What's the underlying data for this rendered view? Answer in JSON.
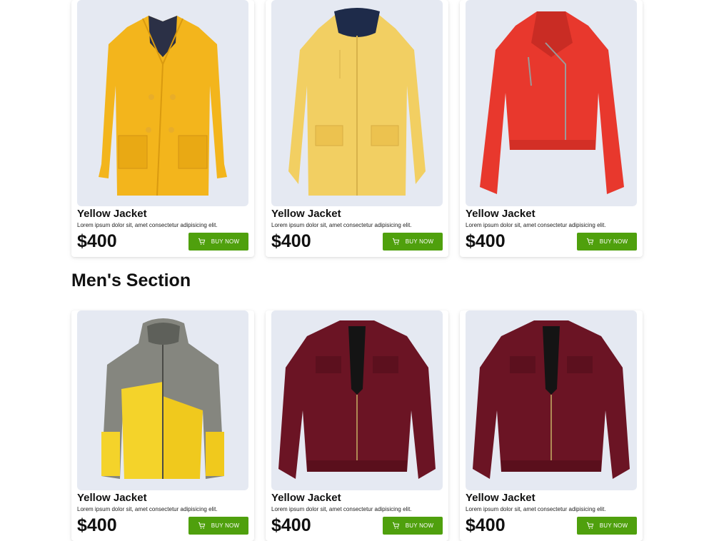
{
  "top_products": [
    {
      "title": "Yellow Jacket",
      "description": "Lorem ipsum dolor sit, amet consectetur adipisicing elit.",
      "price": "$400",
      "button": "BUY NOW",
      "image_name": "yellow-pea-coat-image",
      "color": "#f3b51c"
    },
    {
      "title": "Yellow Jacket",
      "description": "Lorem ipsum dolor sit, amet consectetur adipisicing elit.",
      "price": "$400",
      "button": "BUY NOW",
      "image_name": "yellow-raincoat-image",
      "color": "#f2cf62"
    },
    {
      "title": "Yellow Jacket",
      "description": "Lorem ipsum dolor sit, amet consectetur adipisicing elit.",
      "price": "$400",
      "button": "BUY NOW",
      "image_name": "red-leather-jacket-image",
      "color": "#e8382d"
    }
  ],
  "mens_section": {
    "heading": "Men's Section",
    "products": [
      {
        "title": "Yellow Jacket",
        "description": "Lorem ipsum dolor sit, amet consectetur adipisicing elit.",
        "price": "$400",
        "button": "BUY NOW",
        "image_name": "grey-yellow-puffer-image",
        "color": "#f4d32a"
      },
      {
        "title": "Yellow Jacket",
        "description": "Lorem ipsum dolor sit, amet consectetur adipisicing elit.",
        "price": "$400",
        "button": "BUY NOW",
        "image_name": "maroon-leather-jacket-image",
        "color": "#6b1424"
      },
      {
        "title": "Yellow Jacket",
        "description": "Lorem ipsum dolor sit, amet consectetur adipisicing elit.",
        "price": "$400",
        "button": "BUY NOW",
        "image_name": "maroon-leather-jacket-image",
        "color": "#6b1424"
      }
    ]
  },
  "colors": {
    "button": "#4fa00d",
    "image_bg": "#e5e9f2"
  },
  "icons": {
    "cart": "cart-icon"
  }
}
